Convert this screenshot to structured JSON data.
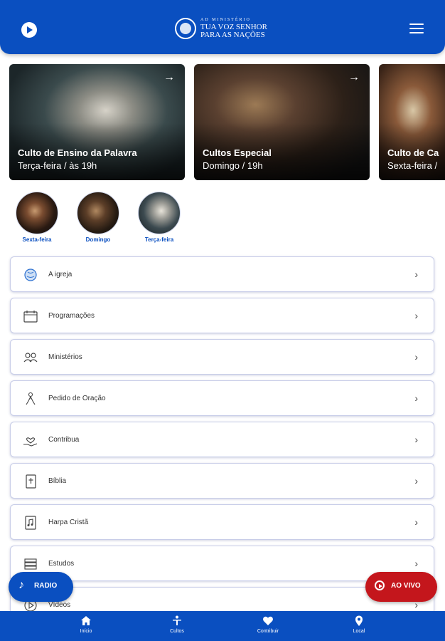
{
  "header": {
    "logo_small": "AD MINISTÉRIO",
    "logo_line1": "TUA VOZ SENHOR",
    "logo_line2": "PARA AS NAÇÕES",
    "accent_color": "#0a4fc0"
  },
  "cards": [
    {
      "title": "Culto de Ensino da Palavra",
      "subtitle": "Terça-feira / às 19h",
      "arrow": "→"
    },
    {
      "title": "Cultos Especial",
      "subtitle": "Domingo / 19h",
      "arrow": "→"
    },
    {
      "title": "Culto de Ca",
      "subtitle": "Sexta-feira /",
      "arrow": "→"
    }
  ],
  "stories": [
    {
      "label": "Sexta-feira"
    },
    {
      "label": "Domingo"
    },
    {
      "label": "Terça-feira"
    }
  ],
  "menu": [
    {
      "label": "A igreja",
      "icon": "globe-icon"
    },
    {
      "label": "Programações",
      "icon": "calendar-icon"
    },
    {
      "label": "Ministérios",
      "icon": "people-icon"
    },
    {
      "label": "Pedido de Oração",
      "icon": "praying-icon"
    },
    {
      "label": "Contribua",
      "icon": "heart-hand-icon"
    },
    {
      "label": "Bíblia",
      "icon": "bible-icon"
    },
    {
      "label": "Harpa Cristã",
      "icon": "hymnal-icon"
    },
    {
      "label": "Estudos",
      "icon": "books-icon"
    },
    {
      "label": "Vídeos",
      "icon": "video-play-icon"
    }
  ],
  "chevron": "›",
  "fab": {
    "radio_label": "RADIO",
    "live_label": "AO VIVO",
    "live_color": "#c4161c"
  },
  "bottom_nav": [
    {
      "label": "Início",
      "icon": "home-icon"
    },
    {
      "label": "Cultos",
      "icon": "cross-person-icon"
    },
    {
      "label": "Contribuir",
      "icon": "heart-icon"
    },
    {
      "label": "Local",
      "icon": "location-pin-icon"
    }
  ]
}
